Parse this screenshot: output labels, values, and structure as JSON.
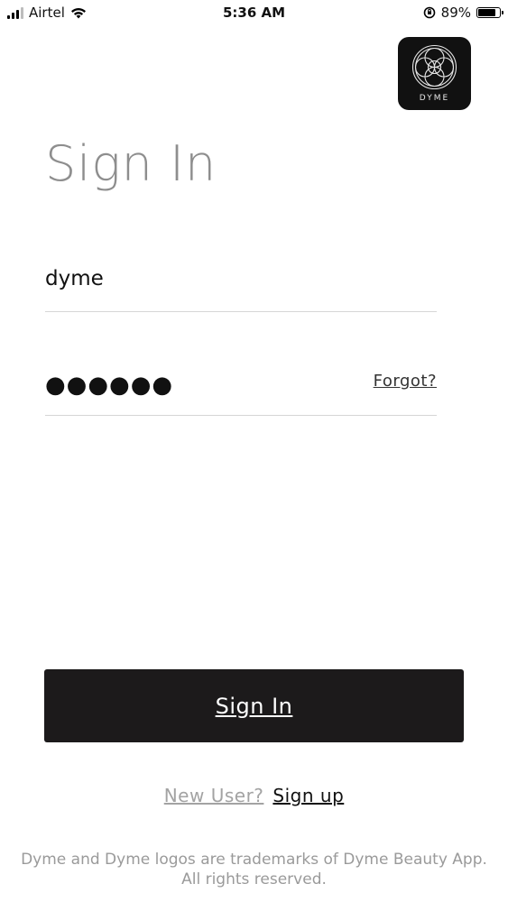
{
  "status_bar": {
    "carrier": "Airtel",
    "time": "5:36 AM",
    "battery_percent": "89%",
    "battery_level": 0.89
  },
  "logo": {
    "text": "DYME"
  },
  "form": {
    "title": "Sign In",
    "username_value": "dyme",
    "password_mask": "●●●●●●",
    "forgot_label": "Forgot?",
    "submit_label": "Sign In"
  },
  "signup": {
    "prompt": "New User?",
    "link_label": "Sign up"
  },
  "footer": {
    "text": "Dyme and Dyme logos are trademarks of Dyme Beauty App. All rights reserved."
  },
  "colors": {
    "button_bg": "#1c1a1b",
    "title": "#8e8e8e",
    "muted": "#a3a3a3"
  }
}
